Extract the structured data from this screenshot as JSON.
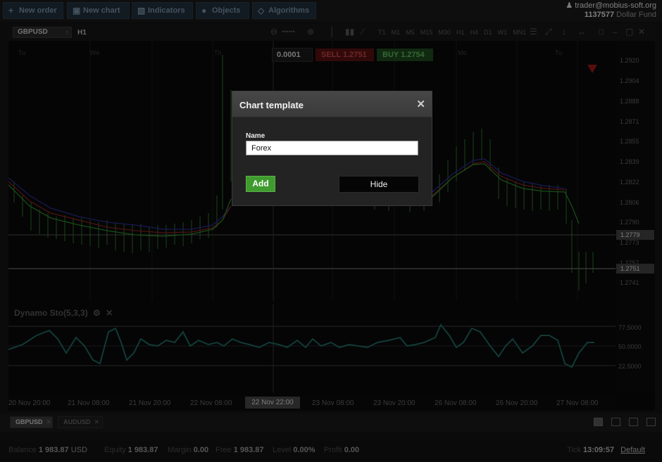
{
  "toolbar": {
    "new_order": "New order",
    "new_chart": "New chart",
    "indicators": "Indicators",
    "objects": "Objects",
    "algorithms": "Algorithms"
  },
  "account": {
    "user": "trader@mobius-soft.org",
    "number": "1137577",
    "fund": "Dollar Fund"
  },
  "chart": {
    "symbol": "GBPUSD",
    "timeframe": "H1",
    "timeframes": [
      "T1",
      "M1",
      "M5",
      "M15",
      "M30",
      "H1",
      "H4",
      "D1",
      "W1",
      "MN1"
    ],
    "days": [
      "Tu",
      "We",
      "Th",
      "Mo",
      "Tu"
    ],
    "quantity": "0.0001",
    "sell_label": "SELL",
    "sell_price": "1.2751",
    "buy_label": "BUY",
    "buy_price": "1.2754",
    "price_labels": [
      "1.2920",
      "1.2904",
      "1.2888",
      "1.2871",
      "1.2855",
      "1.2839",
      "1.2822",
      "1.2806",
      "1.2790",
      "1.2773",
      "1.2757",
      "1.2741"
    ],
    "price_tag_1": "1.2779",
    "price_tag_2": "1.2751",
    "oscillator": {
      "name": "Dynamo Sto(5,3,3)",
      "levels": [
        "77.5000",
        "50.0000",
        "22.5000"
      ]
    },
    "time_labels": [
      "20 Nov 20:00",
      "21 Nov 08:00",
      "21 Nov 20:00",
      "22 Nov 08:00",
      "23 Nov 08:00",
      "23 Nov 20:00",
      "26 Nov 08:00",
      "26 Nov 20:00",
      "27 Nov 08:00"
    ],
    "time_active": "22 Nov 22:00"
  },
  "modal": {
    "title": "Chart template",
    "field_label": "Name",
    "field_value": "Forex",
    "add_label": "Add",
    "hide_label": "Hide"
  },
  "tabs": [
    "GBPUSD",
    "AUDUSD"
  ],
  "status": {
    "balance_label": "Balance",
    "balance_value": "1 983.87",
    "balance_currency": "USD",
    "equity_label": "Equity",
    "equity_value": "1 983.87",
    "margin_label": "Margin",
    "margin_value": "0.00",
    "free_label": "Free",
    "free_value": "1 983.87",
    "level_label": "Level",
    "level_value": "0.00%",
    "profit_label": "Profit",
    "profit_value": "0.00",
    "tick_label": "Tick",
    "tick_value": "13:09:57",
    "template_label": "Default"
  }
}
